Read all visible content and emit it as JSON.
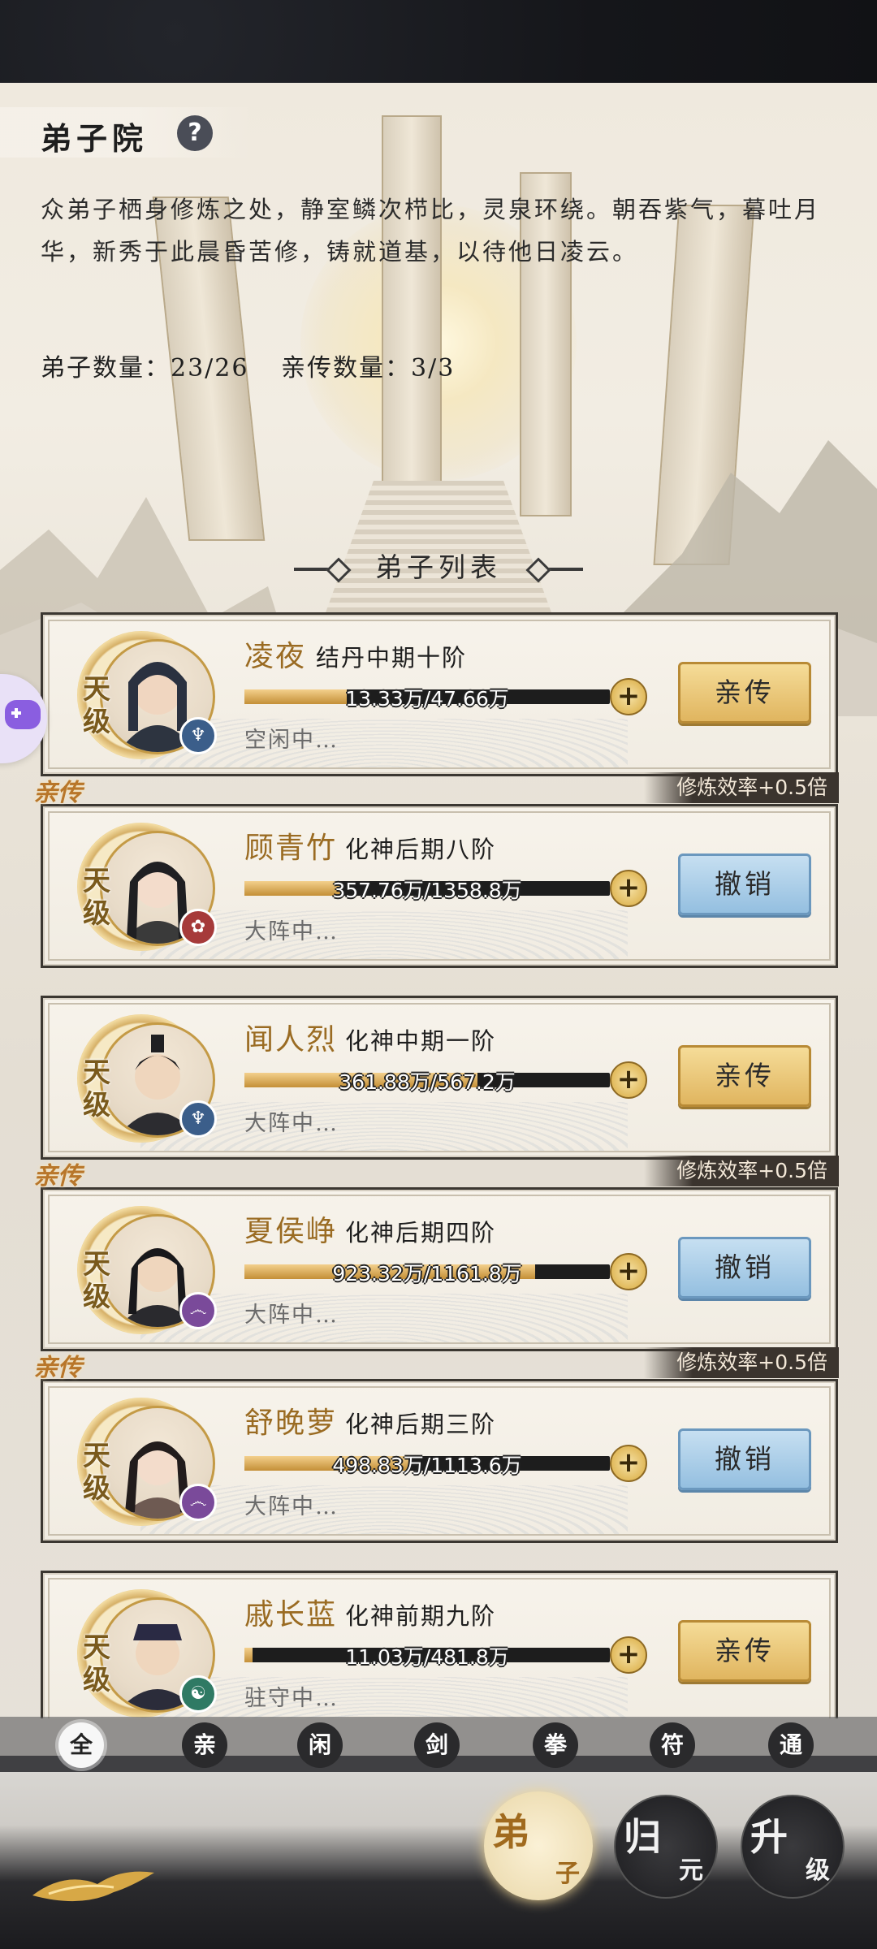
{
  "header": {
    "title": "弟子院",
    "help_icon": "?",
    "description": "众弟子栖身修炼之处，静室鳞次栉比，灵泉环绕。朝吞紫气，暮吐月华，新秀于此晨昏苦修，铸就道基，以待他日凌云。",
    "disciple_count_label": "弟子数量：23/26",
    "inner_count_label": "亲传数量：3/3"
  },
  "list_title": "弟子列表",
  "colors": {
    "gold": "#d8a93c",
    "blue": "#94bfe0",
    "name": "#9a6b22"
  },
  "disciples": [
    {
      "grade": "天级",
      "name": "凌夜",
      "realm": "结丹中期十阶",
      "progress_text": "13.33万/47.66万",
      "progress": 0.28,
      "status": "空闲中…",
      "button": "亲传",
      "button_style": "gold",
      "inner_tag": "",
      "bonus": "",
      "element_icon": "water-icon"
    },
    {
      "grade": "天级",
      "name": "顾青竹",
      "realm": "化神后期八阶",
      "progress_text": "357.76万/1358.8万",
      "progress": 0.263,
      "status": "大阵中…",
      "button": "撤销",
      "button_style": "blue",
      "inner_tag": "亲传",
      "bonus": "修炼效率+0.5倍",
      "element_icon": "fire-icon"
    },
    {
      "grade": "天级",
      "name": "闻人烈",
      "realm": "化神中期一阶",
      "progress_text": "361.88万/567.2万",
      "progress": 0.638,
      "status": "大阵中…",
      "button": "亲传",
      "button_style": "gold",
      "inner_tag": "",
      "bonus": "",
      "element_icon": "water-icon"
    },
    {
      "grade": "天级",
      "name": "夏侯峥",
      "realm": "化神后期四阶",
      "progress_text": "923.32万/1161.8万",
      "progress": 0.795,
      "status": "大阵中…",
      "button": "撤销",
      "button_style": "blue",
      "inner_tag": "亲传",
      "bonus": "修炼效率+0.5倍",
      "element_icon": "swirl-icon"
    },
    {
      "grade": "天级",
      "name": "舒晚萝",
      "realm": "化神后期三阶",
      "progress_text": "498.83万/1113.6万",
      "progress": 0.448,
      "status": "大阵中…",
      "button": "撤销",
      "button_style": "blue",
      "inner_tag": "亲传",
      "bonus": "修炼效率+0.5倍",
      "element_icon": "swirl-icon"
    },
    {
      "grade": "天级",
      "name": "戚长蓝",
      "realm": "化神前期九阶",
      "progress_text": "11.03万/481.8万",
      "progress": 0.023,
      "status": "驻守中…",
      "button": "亲传",
      "button_style": "gold",
      "inner_tag": "",
      "bonus": "",
      "element_icon": "wind-icon"
    }
  ],
  "filters": [
    "全",
    "亲",
    "闲",
    "剑",
    "拳",
    "符",
    "通"
  ],
  "nav": {
    "disciple": [
      "弟",
      "子"
    ],
    "return": [
      "归",
      "元"
    ],
    "upgrade": [
      "升",
      "级"
    ]
  }
}
